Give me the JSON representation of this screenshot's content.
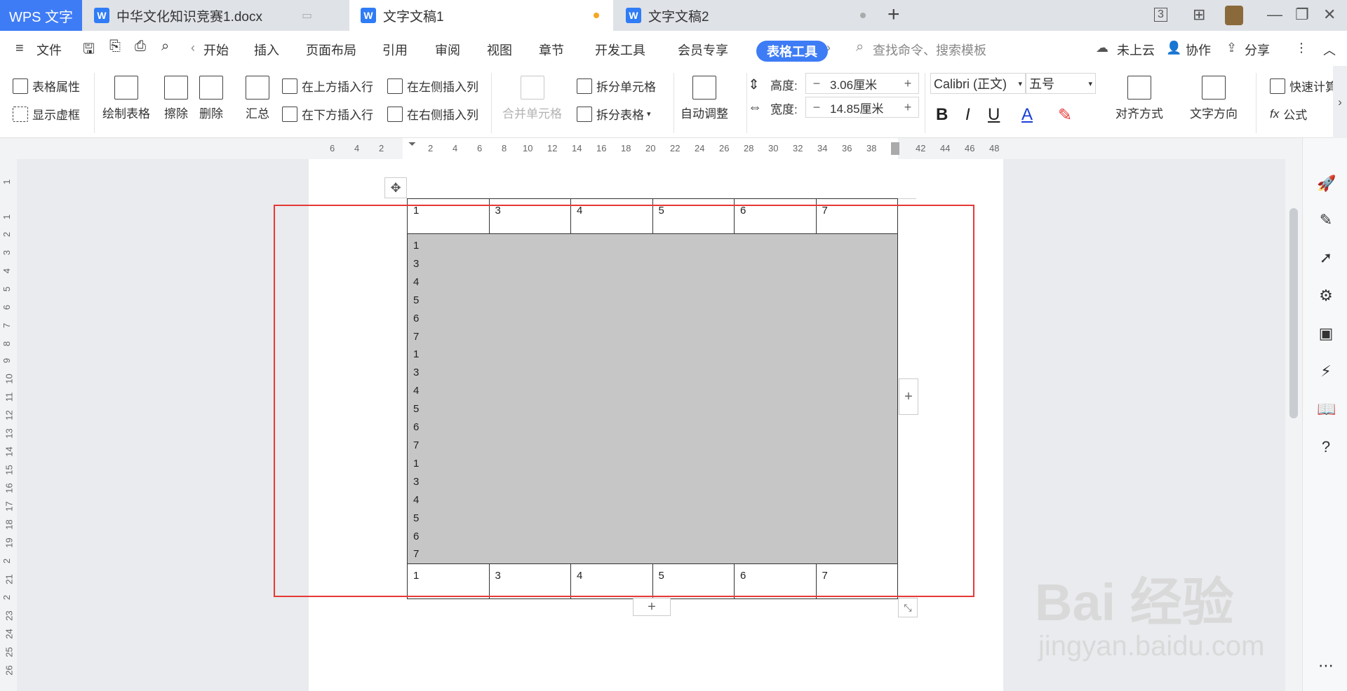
{
  "tabs": {
    "brand": "WPS 文字",
    "items": [
      {
        "label": "中华文化知识竞赛1.docx"
      },
      {
        "label": "文字文稿1"
      },
      {
        "label": "文字文稿2"
      }
    ]
  },
  "menu": {
    "file": "文件",
    "items": [
      "开始",
      "插入",
      "页面布局",
      "引用",
      "审阅",
      "视图",
      "章节",
      "开发工具",
      "会员专享"
    ],
    "table_tools": "表格工具",
    "search_placeholder": "查找命令、搜索模板",
    "cloud": "未上云",
    "collab": "协作",
    "share": "分享"
  },
  "ribbon": {
    "table_props": "表格属性",
    "show_grid": "显示虚框",
    "draw_table": "绘制表格",
    "erase": "擦除",
    "delete": "删除",
    "summary": "汇总",
    "insert_above": "在上方插入行",
    "insert_below": "在下方插入行",
    "insert_left": "在左侧插入列",
    "insert_right": "在右侧插入列",
    "merge_cells": "合并单元格",
    "split_cells": "拆分单元格",
    "split_table": "拆分表格",
    "auto_adjust": "自动调整",
    "height_label": "高度:",
    "height_value": "3.06厘米",
    "width_label": "宽度:",
    "width_value": "14.85厘米",
    "font_name": "Calibri (正文)",
    "font_size": "五号",
    "align": "对齐方式",
    "text_dir": "文字方向",
    "quick_calc": "快速计算",
    "formula": "公式"
  },
  "ruler": {
    "h_numbers": [
      "6",
      "4",
      "2",
      "2",
      "4",
      "6",
      "8",
      "10",
      "12",
      "14",
      "16",
      "18",
      "20",
      "22",
      "24",
      "26",
      "28",
      "30",
      "32",
      "34",
      "36",
      "38",
      "42",
      "44",
      "46",
      "48"
    ],
    "v_numbers": [
      "1",
      "1",
      "2",
      "3",
      "4",
      "5",
      "6",
      "7",
      "8",
      "9",
      "10",
      "11",
      "12",
      "13",
      "14",
      "15",
      "16",
      "17",
      "18",
      "19",
      "2",
      "21",
      "2",
      "23",
      "24",
      "25",
      "26"
    ]
  },
  "table": {
    "header_row": [
      "1",
      "3",
      "4",
      "5",
      "6",
      "7"
    ],
    "merged_lines": [
      "1",
      "3",
      "4",
      "5",
      "6",
      "7",
      "1",
      "3",
      "4",
      "5",
      "6",
      "7",
      "1",
      "3",
      "4",
      "5",
      "6",
      "7"
    ],
    "footer_row": [
      "1",
      "3",
      "4",
      "5",
      "6",
      "7"
    ]
  },
  "watermark": {
    "line1": "Bai 经验",
    "line2": "jingyan.baidu.com"
  }
}
